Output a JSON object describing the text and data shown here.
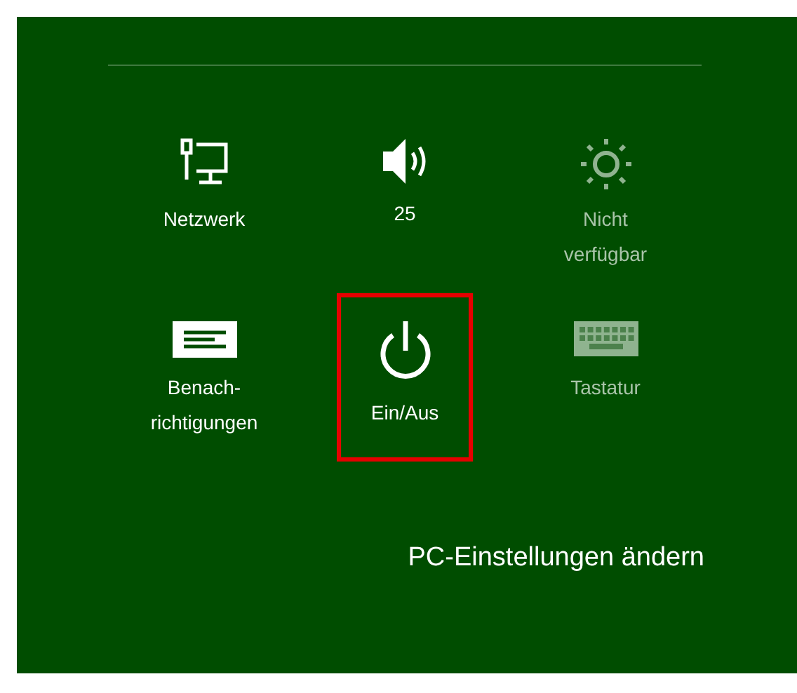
{
  "tiles": [
    {
      "kind": "network",
      "label": "Netzwerk",
      "disabled": false,
      "highlighted": false
    },
    {
      "kind": "volume",
      "label": "25",
      "disabled": false,
      "highlighted": false
    },
    {
      "kind": "brightness",
      "label": "Nicht\nverfügbar",
      "disabled": true,
      "highlighted": false
    },
    {
      "kind": "notifications",
      "label": "Benach-\nrichtigungen",
      "disabled": false,
      "highlighted": false
    },
    {
      "kind": "power",
      "label": "Ein/Aus",
      "disabled": false,
      "highlighted": true
    },
    {
      "kind": "keyboard",
      "label": "Tastatur",
      "disabled": true,
      "highlighted": false
    }
  ],
  "link": "PC-Einstellungen ändern"
}
